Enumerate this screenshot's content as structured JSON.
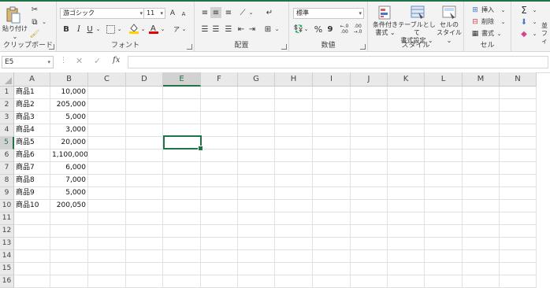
{
  "ribbon": {
    "clipboard": {
      "label": "クリップボード",
      "paste_label": "貼り付け"
    },
    "font": {
      "label": "フォント",
      "font_name": "游ゴシック",
      "font_size": "11",
      "bold": "B",
      "italic": "I",
      "underline": "U",
      "grow": "A",
      "shrink": "A"
    },
    "alignment": {
      "label": "配置"
    },
    "number": {
      "label": "数値",
      "format": "標準",
      "percent": "%",
      "comma": "9",
      "inc_decimal": "←.0\n.00",
      "dec_decimal": ".00\n→.0"
    },
    "styles": {
      "label": "スタイル",
      "conditional_formatting": "条件付き\n書式",
      "format_as_table": "テーブルとして\n書式設定",
      "cell_styles": "セルの\nスタイル"
    },
    "cells": {
      "label": "セル",
      "insert": "挿入",
      "delete": "削除",
      "format": "書式"
    },
    "editing": {
      "sum": "Σ",
      "sort_filter": "並\nフィ"
    }
  },
  "formula_bar": {
    "name_box": "E5",
    "fx": "fx",
    "formula": ""
  },
  "columns": [
    "A",
    "B",
    "C",
    "D",
    "E",
    "F",
    "G",
    "H",
    "I",
    "J",
    "K",
    "L",
    "M",
    "N"
  ],
  "selected_column": "E",
  "selected_row": 5,
  "rows": [
    "1",
    "2",
    "3",
    "4",
    "5",
    "6",
    "7",
    "8",
    "9",
    "10",
    "11",
    "12",
    "13",
    "14",
    "15",
    "16"
  ],
  "cells": {
    "A": [
      "商品1",
      "商品2",
      "商品3",
      "商品4",
      "商品5",
      "商品6",
      "商品7",
      "商品8",
      "商品9",
      "商品10"
    ],
    "B": [
      "10,000",
      "205,000",
      "5,000",
      "3,000",
      "20,000",
      "1,100,000",
      "6,000",
      "7,000",
      "5,000",
      "200,050"
    ]
  }
}
